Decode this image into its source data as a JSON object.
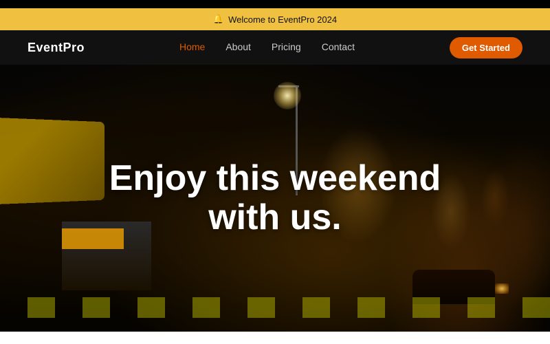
{
  "announcement": {
    "icon": "🔔",
    "text": "Welcome to EventPro 2024"
  },
  "navbar": {
    "logo": "EventPro",
    "links": [
      {
        "label": "Home",
        "active": true
      },
      {
        "label": "About",
        "active": false
      },
      {
        "label": "Pricing",
        "active": false
      },
      {
        "label": "Contact",
        "active": false
      }
    ],
    "cta_label": "Get Started"
  },
  "hero": {
    "title_line1": "Enjoy this weekend",
    "title_line2": "with us."
  },
  "colors": {
    "accent_orange": "#e05a00",
    "announcement_bg": "#f0c040",
    "nav_bg": "#111111"
  }
}
